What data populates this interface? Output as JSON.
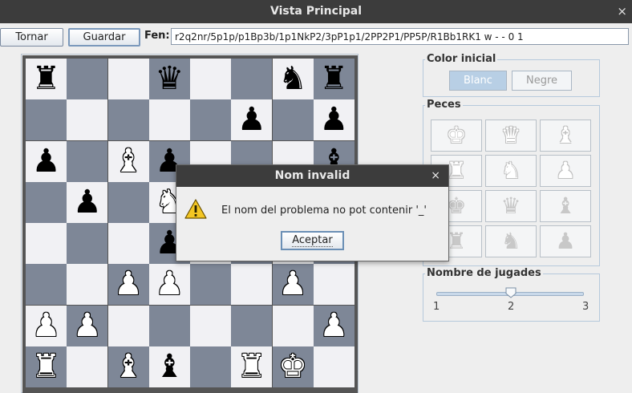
{
  "window": {
    "title": "Vista Principal",
    "close_glyph": "×"
  },
  "toolbar": {
    "back_label": "Tornar",
    "save_label": "Guardar",
    "fen_label": "Fen:",
    "fen_value": "r2q2nr/5p1p/p1Bp3b/1p1NkP2/3pP1p1/2PP2P1/PP5P/R1Bb1RK1 w - - 0 1"
  },
  "board": {
    "light_color": "#f1f1f4",
    "dark_color": "#7e8797",
    "ranks": [
      [
        "br",
        "",
        "",
        "bq",
        "",
        "",
        "bn",
        "br"
      ],
      [
        "",
        "",
        "",
        "",
        "",
        "bp",
        "",
        "bp"
      ],
      [
        "bp",
        "",
        "wb",
        "bp",
        "",
        "",
        "",
        "bb"
      ],
      [
        "",
        "bp",
        "",
        "wn",
        "",
        "",
        "",
        ""
      ],
      [
        "",
        "",
        "",
        "bp",
        "",
        "",
        "",
        ""
      ],
      [
        "",
        "",
        "wp",
        "wp",
        "",
        "",
        "wp",
        ""
      ],
      [
        "wp",
        "wp",
        "",
        "",
        "",
        "",
        "",
        "wp"
      ],
      [
        "wr",
        "",
        "wb",
        "bb",
        "",
        "wr",
        "wk",
        ""
      ]
    ]
  },
  "color_group": {
    "label": "Color inicial",
    "white_label": "Blanc",
    "black_label": "Negre",
    "selected": "Blanc"
  },
  "pieces_group": {
    "label": "Peces",
    "buttons": [
      {
        "icon": "white-king-icon",
        "glyph": "♚",
        "side": "w"
      },
      {
        "icon": "white-queen-icon",
        "glyph": "♛",
        "side": "w"
      },
      {
        "icon": "white-bishop-icon",
        "glyph": "♝",
        "side": "w"
      },
      {
        "icon": "white-rook-icon",
        "glyph": "♜",
        "side": "w"
      },
      {
        "icon": "white-knight-icon",
        "glyph": "♞",
        "side": "w"
      },
      {
        "icon": "white-pawn-icon",
        "glyph": "♟",
        "side": "w"
      },
      {
        "icon": "black-king-icon",
        "glyph": "♚",
        "side": "b"
      },
      {
        "icon": "black-queen-icon",
        "glyph": "♛",
        "side": "b"
      },
      {
        "icon": "black-bishop-icon",
        "glyph": "♝",
        "side": "b"
      },
      {
        "icon": "black-rook-icon",
        "glyph": "♜",
        "side": "b"
      },
      {
        "icon": "black-knight-icon",
        "glyph": "♞",
        "side": "b"
      },
      {
        "icon": "black-pawn-icon",
        "glyph": "♟",
        "side": "b"
      }
    ]
  },
  "moves_group": {
    "label": "Nombre de jugades",
    "min_label": "1",
    "mid_label": "2",
    "max_label": "3",
    "value": 2
  },
  "dialog": {
    "title": "Nom invalid",
    "close_glyph": "×",
    "message": "El nom del problema no pot contenir '_'",
    "accept_label": "Aceptar"
  }
}
